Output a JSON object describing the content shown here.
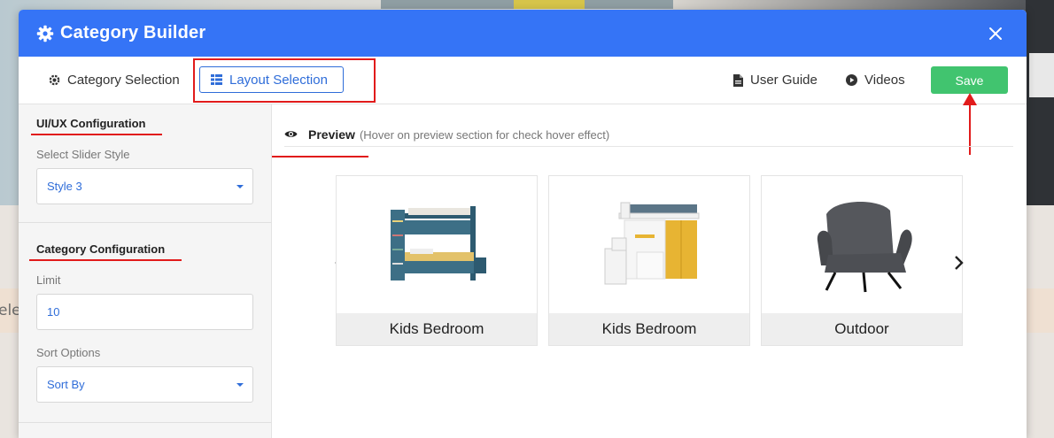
{
  "background": {
    "partial_text": "ele"
  },
  "modal": {
    "title": "Category Builder",
    "header_color": "#3574f6",
    "icons": {
      "title": "gear-icon",
      "close": "close-icon"
    }
  },
  "toolbar": {
    "category_selection": "Category Selection",
    "layout_selection": "Layout Selection",
    "user_guide": "User Guide",
    "videos": "Videos",
    "save": "Save",
    "save_color": "#41c46f",
    "accent": "#2f6dd9",
    "annotation_color": "#e11b1b"
  },
  "sidebar": {
    "uiux": {
      "title": "UI/UX Configuration",
      "slider_label": "Select Slider Style",
      "slider_value": "Style 3"
    },
    "category": {
      "title": "Category Configuration",
      "limit_label": "Limit",
      "limit_value": "10",
      "sort_label": "Sort Options",
      "sort_value": "Sort By"
    }
  },
  "preview": {
    "title": "Preview",
    "hint": "(Hover on preview section for check hover effect)",
    "cards": [
      {
        "label": "Kids Bedroom",
        "image": "bunk-bed-image"
      },
      {
        "label": "Kids Bedroom",
        "image": "loft-bed-image"
      },
      {
        "label": "Outdoor",
        "image": "lounge-chair-image"
      }
    ]
  }
}
